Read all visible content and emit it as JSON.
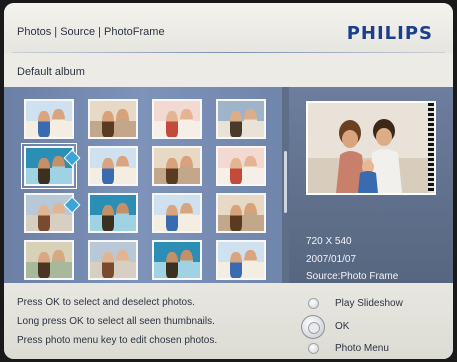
{
  "header": {
    "breadcrumb": "Photos | Source | PhotoFrame",
    "brand": "PHILIPS"
  },
  "album": {
    "title": "Default album"
  },
  "thumbnails": [
    {
      "label": "thumbnail-1",
      "selected": false,
      "checked": false
    },
    {
      "label": "thumbnail-2",
      "selected": false,
      "checked": false
    },
    {
      "label": "thumbnail-3",
      "selected": false,
      "checked": false
    },
    {
      "label": "thumbnail-4",
      "selected": false,
      "checked": false
    },
    {
      "label": "thumbnail-5",
      "selected": true,
      "checked": true
    },
    {
      "label": "thumbnail-6",
      "selected": false,
      "checked": false
    },
    {
      "label": "thumbnail-7",
      "selected": false,
      "checked": false
    },
    {
      "label": "thumbnail-8",
      "selected": false,
      "checked": false
    },
    {
      "label": "thumbnail-9",
      "selected": false,
      "checked": true
    },
    {
      "label": "thumbnail-10",
      "selected": false,
      "checked": false
    },
    {
      "label": "thumbnail-11",
      "selected": false,
      "checked": false
    },
    {
      "label": "thumbnail-12",
      "selected": false,
      "checked": false
    },
    {
      "label": "thumbnail-13",
      "selected": false,
      "checked": false
    },
    {
      "label": "thumbnail-14",
      "selected": false,
      "checked": false
    },
    {
      "label": "thumbnail-15",
      "selected": false,
      "checked": false
    },
    {
      "label": "thumbnail-16",
      "selected": false,
      "checked": false
    }
  ],
  "preview": {
    "resolution": "720 X 540",
    "date": "2007/01/07",
    "source": "Source:Photo Frame"
  },
  "help": {
    "line1": "Press OK to select and deselect photos.",
    "line2": "Long press OK to select all seen thumbnails.",
    "line3": "Press photo menu key to edit chosen photos."
  },
  "menu": {
    "play_slideshow": "Play Slideshow",
    "ok": "OK",
    "photo_menu": "Photo Menu"
  },
  "colors": {
    "brand": "#1b3f8c",
    "panel": "#7e93b9",
    "check": "#3ba6d6"
  }
}
